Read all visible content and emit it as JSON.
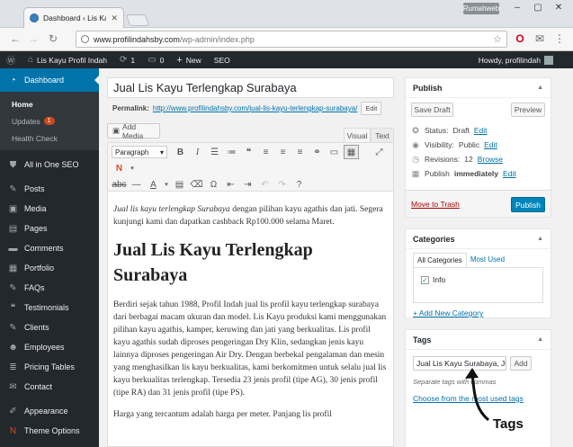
{
  "browser": {
    "tab_title": "Dashboard ‹ Lis Kayu Pro",
    "profile_badge": "Rumahweb",
    "url_host": "www.profilindahsby.com",
    "url_path": "/wp-admin/index.php"
  },
  "adminbar": {
    "site_name": "Lis Kayu Profil Indah",
    "updates_count": "1",
    "comments_count": "0",
    "new_label": "New",
    "seo_label": "SEO",
    "howdy": "Howdy, profilindah"
  },
  "sidebar": {
    "dashboard": "Dashboard",
    "submenu": {
      "home": "Home",
      "updates": "Updates",
      "updates_badge": "1",
      "health": "Health Check"
    },
    "items": [
      "All in One SEO",
      "Posts",
      "Media",
      "Pages",
      "Comments",
      "Portfolio",
      "FAQs",
      "Testimonials",
      "Clients",
      "Employees",
      "Pricing Tables",
      "Contact",
      "Appearance",
      "Theme Options"
    ]
  },
  "editor": {
    "title": "Jual Lis Kayu Terlengkap Surabaya",
    "permalink_label": "Permalink:",
    "permalink_base": "http://www.profilindahsby.com/",
    "permalink_slug": "jual-lis-kayu-terlengkap-surabaya/",
    "edit_label": "Edit",
    "add_media": "Add Media",
    "tab_visual": "Visual",
    "tab_text": "Text",
    "format_select": "Paragraph",
    "intro_italic": "Jual lis kayu terlengkap Surabaya",
    "intro_rest": " dengan pilihan kayu agathis dan jati. Segera kunjungi kami dan dapatkan cashback Rp100.000 selama Maret.",
    "heading": "Jual Lis Kayu Terlengkap Surabaya",
    "para1": "Berdiri sejak tahun 1988, Profil Indah jual lis profil kayu terlengkap surabaya dari berbagai macam ukuran dan model. Lis Kayu produksi kami menggunakan pilihan kayu agathis, kamper, keruwing dan jati yang berkualitas. Lis profil kayu agathis sudah diproses pengeringan Dry Klin, sedangkan jenis kayu lainnya diproses pengeringan Air Dry. Dengan berbekal pengalaman dan mesin yang menghasilkan lis kayu berkualitas, kami berkomitmen untuk selalu jual lis kayu berkualitas terlengkap. Tersedia 23 jenis profil (tipe AG), 30 jenis profil (tipe RA) dan 31 jenis profil (tipe PS).",
    "para2": "Harga yang tercantum adalah harga per meter. Panjang lis profil"
  },
  "publish": {
    "title": "Publish",
    "save_draft": "Save Draft",
    "preview": "Preview",
    "status_label": "Status: ",
    "status_value": "Draft",
    "visibility_label": "Visibility: ",
    "visibility_value": "Public",
    "revisions_label": "Revisions: ",
    "revisions_value": "12",
    "browse": "Browse",
    "schedule_label": "Publish ",
    "schedule_value": "immediately",
    "edit": "Edit",
    "trash": "Move to Trash",
    "publish_button": "Publish"
  },
  "categories": {
    "title": "Categories",
    "tab_all": "All Categories",
    "tab_most": "Most Used",
    "items": [
      {
        "label": "Info",
        "checked": true
      }
    ],
    "add_new": "+ Add New Category"
  },
  "tags": {
    "title": "Tags",
    "input_value": "Jual Lis Kayu Surabaya, Jual",
    "add_button": "Add",
    "hint": "Separate tags with commas",
    "choose_link": "Choose from the most used tags",
    "annotation": "Tags"
  },
  "colors": {
    "wp_blue": "#0073aa",
    "admin_dark": "#23282d",
    "publish_blue": "#0085ba",
    "trash_red": "#a00"
  }
}
